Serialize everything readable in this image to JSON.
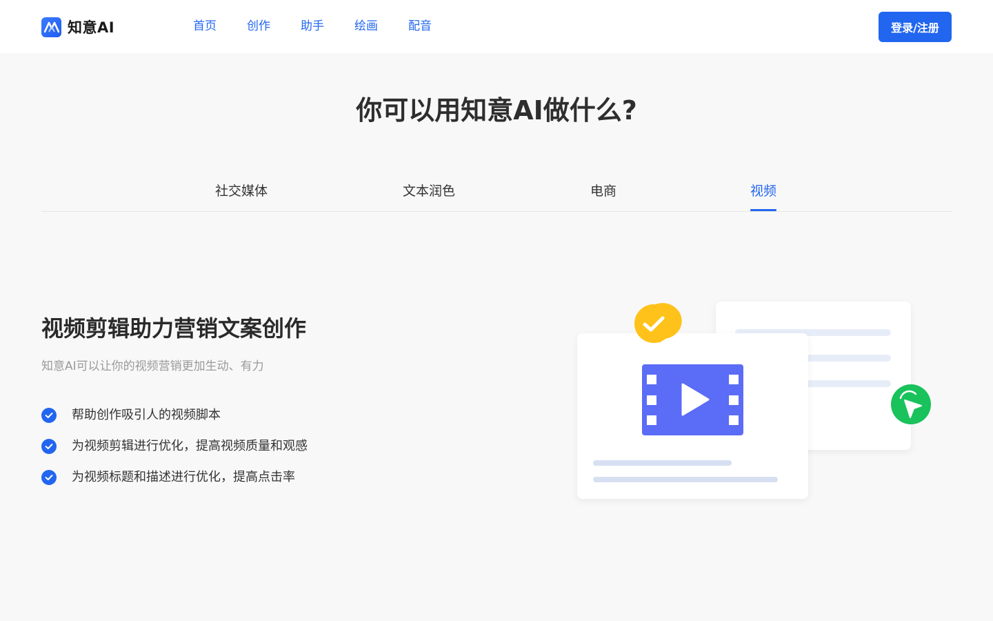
{
  "header": {
    "brand": "知意AI",
    "nav": [
      "首页",
      "创作",
      "助手",
      "绘画",
      "配音"
    ],
    "login_label": "登录/注册"
  },
  "hero": {
    "title": "你可以用知意AI做什么?"
  },
  "tabs": [
    {
      "label": "社交媒体",
      "active": false
    },
    {
      "label": "文本润色",
      "active": false
    },
    {
      "label": "电商",
      "active": false
    },
    {
      "label": "视频",
      "active": true
    }
  ],
  "feature": {
    "title": "视频剪辑助力营销文案创作",
    "subtitle": "知意AI可以让你的视频营销更加生动、有力",
    "bullets": [
      "帮助创作吸引人的视频脚本",
      "为视频剪辑进行优化，提高视频质量和观感",
      "为视频标题和描述进行优化，提高点击率"
    ]
  },
  "colors": {
    "accent": "#2266f0",
    "page_bg": "#f8f8f8",
    "film_purple": "#5b6cf6",
    "badge_yellow": "#ffc21a",
    "cursor_green": "#19c25b"
  }
}
